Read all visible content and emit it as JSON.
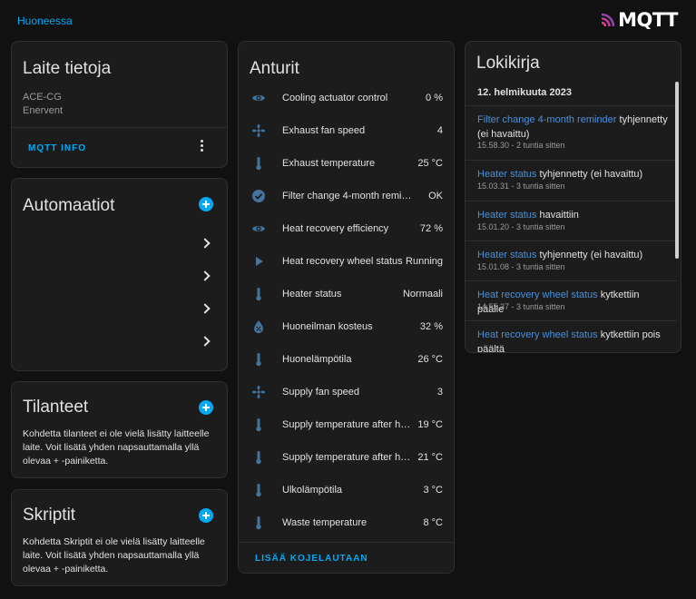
{
  "header": {
    "breadcrumb": "Huoneessa",
    "logo_text": "MQTT"
  },
  "device_info": {
    "title": "Laite tietoja",
    "model": "ACE-CG",
    "manufacturer": "Enervent",
    "mqtt_info_label": "MQTT INFO"
  },
  "automations": {
    "title": "Automaatiot",
    "rows": 4
  },
  "scenes": {
    "title": "Tilanteet",
    "empty_text": "Kohdetta tilanteet ei ole vielä lisätty laitteelle laite. Voit lisätä yhden napsauttamalla yllä olevaa + -painiketta."
  },
  "scripts": {
    "title": "Skriptit",
    "empty_text": "Kohdetta Skriptit ei ole vielä lisätty laitteelle laite. Voit lisätä yhden napsauttamalla yllä olevaa + -painiketta."
  },
  "sensors": {
    "title": "Anturit",
    "add_label": "LISÄÄ KOJELAUTAAN",
    "items": [
      {
        "icon": "eye-icon",
        "name": "Cooling actuator control",
        "value": "0 %"
      },
      {
        "icon": "fan-icon",
        "name": "Exhaust fan speed",
        "value": "4"
      },
      {
        "icon": "thermometer-icon",
        "name": "Exhaust temperature",
        "value": "25 °C"
      },
      {
        "icon": "check-circle-icon",
        "name": "Filter change 4-month reminder",
        "value": "OK"
      },
      {
        "icon": "eye-icon",
        "name": "Heat recovery efficiency",
        "value": "72 %"
      },
      {
        "icon": "play-icon",
        "name": "Heat recovery wheel status",
        "value": "Running"
      },
      {
        "icon": "thermometer-icon",
        "name": "Heater status",
        "value": "Normaali"
      },
      {
        "icon": "water-percent-icon",
        "name": "Huoneilman kosteus",
        "value": "32 %"
      },
      {
        "icon": "thermometer-icon",
        "name": "Huonelämpötila",
        "value": "26 °C"
      },
      {
        "icon": "fan-icon",
        "name": "Supply fan speed",
        "value": "3"
      },
      {
        "icon": "thermometer-icon",
        "name": "Supply temperature after hea…",
        "value": "19 °C"
      },
      {
        "icon": "thermometer-icon",
        "name": "Supply temperature after hea…",
        "value": "21 °C"
      },
      {
        "icon": "thermometer-icon",
        "name": "Ulkolämpötila",
        "value": "3 °C"
      },
      {
        "icon": "thermometer-icon",
        "name": "Waste temperature",
        "value": "8 °C"
      }
    ]
  },
  "logbook": {
    "title": "Lokikirja",
    "date": "12. helmikuuta 2023",
    "entries": [
      {
        "entity": "Filter change 4-month reminder",
        "message": " tyhjennetty (ei havaittu)",
        "time": "15.58.30 - 2 tuntia sitten"
      },
      {
        "entity": "Heater status",
        "message": " tyhjennetty (ei havaittu)",
        "time": "15.03.31 - 3 tuntia sitten"
      },
      {
        "entity": "Heater status",
        "message": " havaittiin",
        "time": "15.01.20 - 3 tuntia sitten"
      },
      {
        "entity": "Heater status",
        "message": " tyhjennetty (ei havaittu)",
        "time": "15.01.08 - 3 tuntia sitten"
      },
      {
        "entity": "Heat recovery wheel status",
        "message": " kytkettiin päälle",
        "time": "14.55.37 - 3 tuntia sitten"
      },
      {
        "entity": "Heat recovery wheel status",
        "message": " kytkettiin pois päältä",
        "time": ""
      }
    ]
  },
  "colors": {
    "accent": "#03a9f4",
    "icon": "#44739e",
    "entity_link": "#4e8fd3",
    "card_bg": "#1c1c1c",
    "page_bg": "#111111"
  }
}
